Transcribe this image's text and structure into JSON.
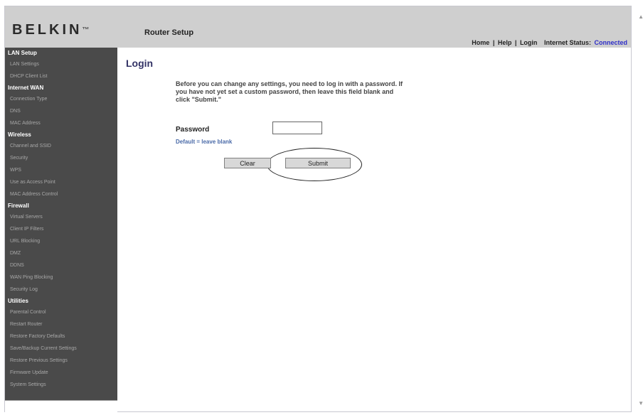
{
  "header": {
    "brand": "BELKIN",
    "brand_mark": "™",
    "title": "Router Setup",
    "nav": {
      "home": "Home",
      "help": "Help",
      "login": "Login",
      "sep": "|",
      "status_label": "Internet Status:",
      "status_value": "Connected"
    }
  },
  "sidebar": {
    "lan_setup": "LAN Setup",
    "lan_items": [
      "LAN Settings",
      "DHCP Client List"
    ],
    "internet_wan": "Internet WAN",
    "wan_items": [
      "Connection Type",
      "DNS",
      "MAC Address"
    ],
    "wireless": "Wireless",
    "wireless_items": [
      "Channel and SSID",
      "Security",
      "WPS",
      "Use as Access Point",
      "MAC Address Control"
    ],
    "firewall": "Firewall",
    "firewall_items": [
      "Virtual Servers",
      "Client IP Filters",
      "URL Blocking",
      "DMZ",
      "DDNS",
      "WAN Ping Blocking",
      "Security Log"
    ],
    "utilities": "Utilities",
    "utilities_items": [
      "Parental Control",
      "Restart Router",
      "Restore Factory Defaults",
      "Save/Backup Current Settings",
      "Restore Previous Settings",
      "Firmware Update",
      "System Settings"
    ]
  },
  "main": {
    "title": "Login",
    "intro": "Before you can change any settings, you need to log in with a password. If you have not yet set a custom password, then leave this field blank and click \"Submit.\"",
    "password_label": "Password",
    "password_value": "",
    "default_note": "Default = leave blank",
    "clear_label": "Clear",
    "submit_label": "Submit"
  },
  "scroll": {
    "up": "▲",
    "down": "▼"
  }
}
